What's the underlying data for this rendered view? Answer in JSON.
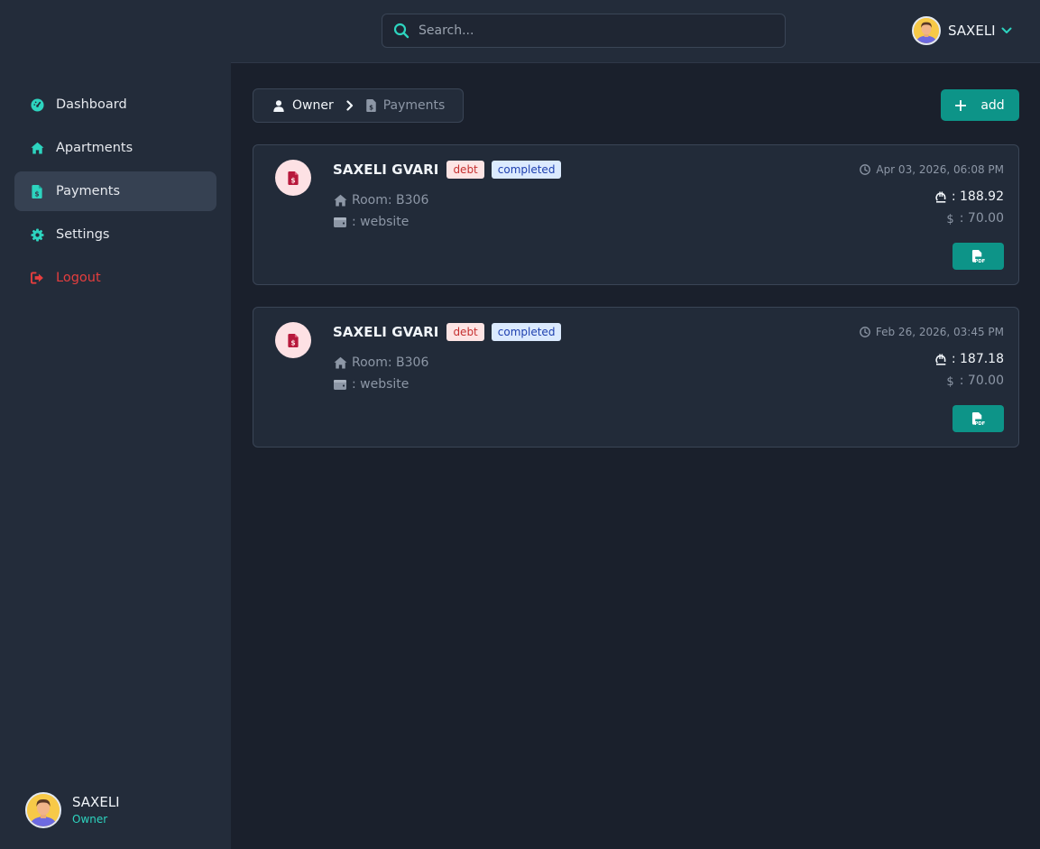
{
  "search": {
    "placeholder": "Search..."
  },
  "topbar": {
    "user_name": "SAXELI"
  },
  "sidebar": {
    "items": [
      {
        "label": "Dashboard",
        "icon": "gauge-icon"
      },
      {
        "label": "Apartments",
        "icon": "home-icon"
      },
      {
        "label": "Payments",
        "icon": "file-invoice-dollar-icon",
        "active": true
      },
      {
        "label": "Settings",
        "icon": "gear-icon"
      },
      {
        "label": "Logout",
        "icon": "logout-icon"
      }
    ],
    "user": {
      "name": "SAXELI",
      "role": "Owner"
    }
  },
  "breadcrumb": {
    "owner": "Owner",
    "current": "Payments"
  },
  "actions": {
    "add_label": "add"
  },
  "payments": [
    {
      "name": "SAXELI GVARI",
      "type_badge": "debt",
      "status_badge": "completed",
      "room": "Room: B306",
      "method": ": website",
      "date": "Apr 03, 2026, 06:08 PM",
      "amount_gel": ": 188.92",
      "amount_usd": ": 70.00"
    },
    {
      "name": "SAXELI GVARI",
      "type_badge": "debt",
      "status_badge": "completed",
      "room": "Room: B306",
      "method": ": website",
      "date": "Feb 26, 2026, 03:45 PM",
      "amount_gel": ": 187.18",
      "amount_usd": ": 70.00"
    }
  ],
  "colors": {
    "accent": "#0d9488",
    "accent_text": "#2dd4bf",
    "logout": "#e53e3e",
    "badge_debt_bg": "#fde4e4",
    "badge_debt_text": "#c53030",
    "badge_completed_bg": "#dbeafe",
    "badge_completed_text": "#1e40af"
  }
}
